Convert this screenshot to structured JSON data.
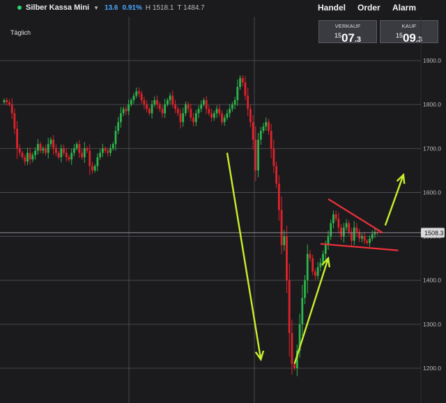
{
  "topbar": {
    "instrument": "Silber Kassa Mini",
    "change": "13.6",
    "change_pct": "0.91%",
    "high": "H 1518.1",
    "low": "T 1484.7",
    "menu": [
      "Handel",
      "Order",
      "Alarm"
    ]
  },
  "timeframe": "Täglich",
  "quotes": {
    "sell_label": "VERKAUF",
    "sell_big": "15",
    "sell_main": "07",
    "sell_small": ".3",
    "buy_label": "KAUF",
    "buy_big": "15",
    "buy_main": "09",
    "buy_small": ".3"
  },
  "colors": {
    "up": "#2eb54b",
    "down": "#e0232b",
    "arrow": "#c8ef2c",
    "triangle": "#f0303a",
    "grid": "#56565a",
    "live": "#2ed36f",
    "change": "#48a8ff"
  },
  "chart_data": {
    "type": "candlestick",
    "y_ticks": [
      "1900.0",
      "1800.0",
      "1700.0",
      "1600.0",
      "1500.0",
      "1400.0",
      "1300.0",
      "1200.0"
    ],
    "ylim": [
      1120,
      1940
    ],
    "last_price": "1508.3",
    "grid": true,
    "closes": [
      1810,
      1805,
      1800,
      1780,
      1745,
      1700,
      1690,
      1680,
      1670,
      1690,
      1675,
      1685,
      1695,
      1710,
      1695,
      1700,
      1690,
      1710,
      1720,
      1700,
      1690,
      1680,
      1700,
      1690,
      1680,
      1675,
      1690,
      1700,
      1710,
      1690,
      1680,
      1700,
      1695,
      1660,
      1650,
      1660,
      1680,
      1690,
      1700,
      1695,
      1690,
      1700,
      1710,
      1740,
      1760,
      1780,
      1790,
      1785,
      1800,
      1810,
      1820,
      1830,
      1825,
      1810,
      1800,
      1790,
      1780,
      1800,
      1810,
      1800,
      1790,
      1780,
      1800,
      1810,
      1820,
      1800,
      1790,
      1780,
      1760,
      1780,
      1800,
      1790,
      1770,
      1760,
      1780,
      1790,
      1800,
      1810,
      1790,
      1780,
      1770,
      1780,
      1790,
      1780,
      1760,
      1770,
      1780,
      1790,
      1800,
      1810,
      1840,
      1860,
      1850,
      1820,
      1790,
      1760,
      1720,
      1650,
      1720,
      1740,
      1750,
      1760,
      1740,
      1700,
      1660,
      1620,
      1560,
      1480,
      1500,
      1400,
      1280,
      1210,
      1200,
      1240,
      1300,
      1360,
      1400,
      1460,
      1450,
      1420,
      1410,
      1430,
      1440,
      1460,
      1480,
      1500,
      1530,
      1550,
      1540,
      1520,
      1500,
      1520,
      1530,
      1510,
      1490,
      1520,
      1510,
      1495,
      1500,
      1490,
      1485,
      1495,
      1505,
      1510,
      1508
    ],
    "annotations": [
      {
        "kind": "arrow",
        "from": [
          86,
          1690
        ],
        "to": [
          99,
          1220
        ]
      },
      {
        "kind": "arrow",
        "from": [
          112,
          1210
        ],
        "to": [
          125,
          1450
        ]
      },
      {
        "kind": "arrow",
        "from": [
          147,
          1525
        ],
        "to": [
          154,
          1640
        ]
      },
      {
        "kind": "line",
        "from": [
          125,
          1585
        ],
        "to": [
          146,
          1508
        ]
      },
      {
        "kind": "line",
        "from": [
          122,
          1483
        ],
        "to": [
          152,
          1468
        ]
      }
    ]
  }
}
